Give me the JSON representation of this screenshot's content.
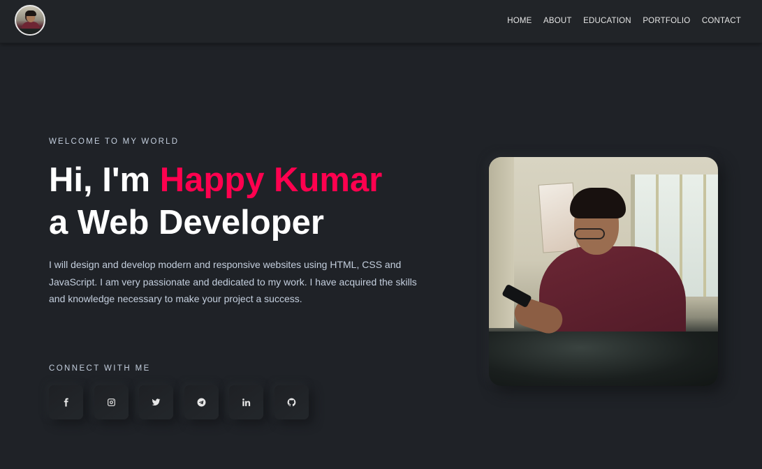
{
  "header": {
    "nav": [
      "HOME",
      "ABOUT",
      "EDUCATION",
      "PORTFOLIO",
      "CONTACT"
    ]
  },
  "hero": {
    "eyebrow": "WELCOME TO MY WORLD",
    "greeting": "Hi, I'm ",
    "name": "Happy Kumar",
    "role_line": "a Web Developer",
    "description": "I will design and develop modern and responsive websites using HTML, CSS and JavaScript. I am very passionate and dedicated to my work. I have acquired the skills and knowledge necessary to make your project a success.",
    "connect_label": "CONNECT WITH ME",
    "socials": [
      "facebook-icon",
      "instagram-icon",
      "twitter-icon",
      "telegram-icon",
      "linkedin-icon",
      "github-icon"
    ]
  },
  "colors": {
    "background": "#1f2227",
    "accent": "#ff014f",
    "body_text": "#c4cfde"
  }
}
